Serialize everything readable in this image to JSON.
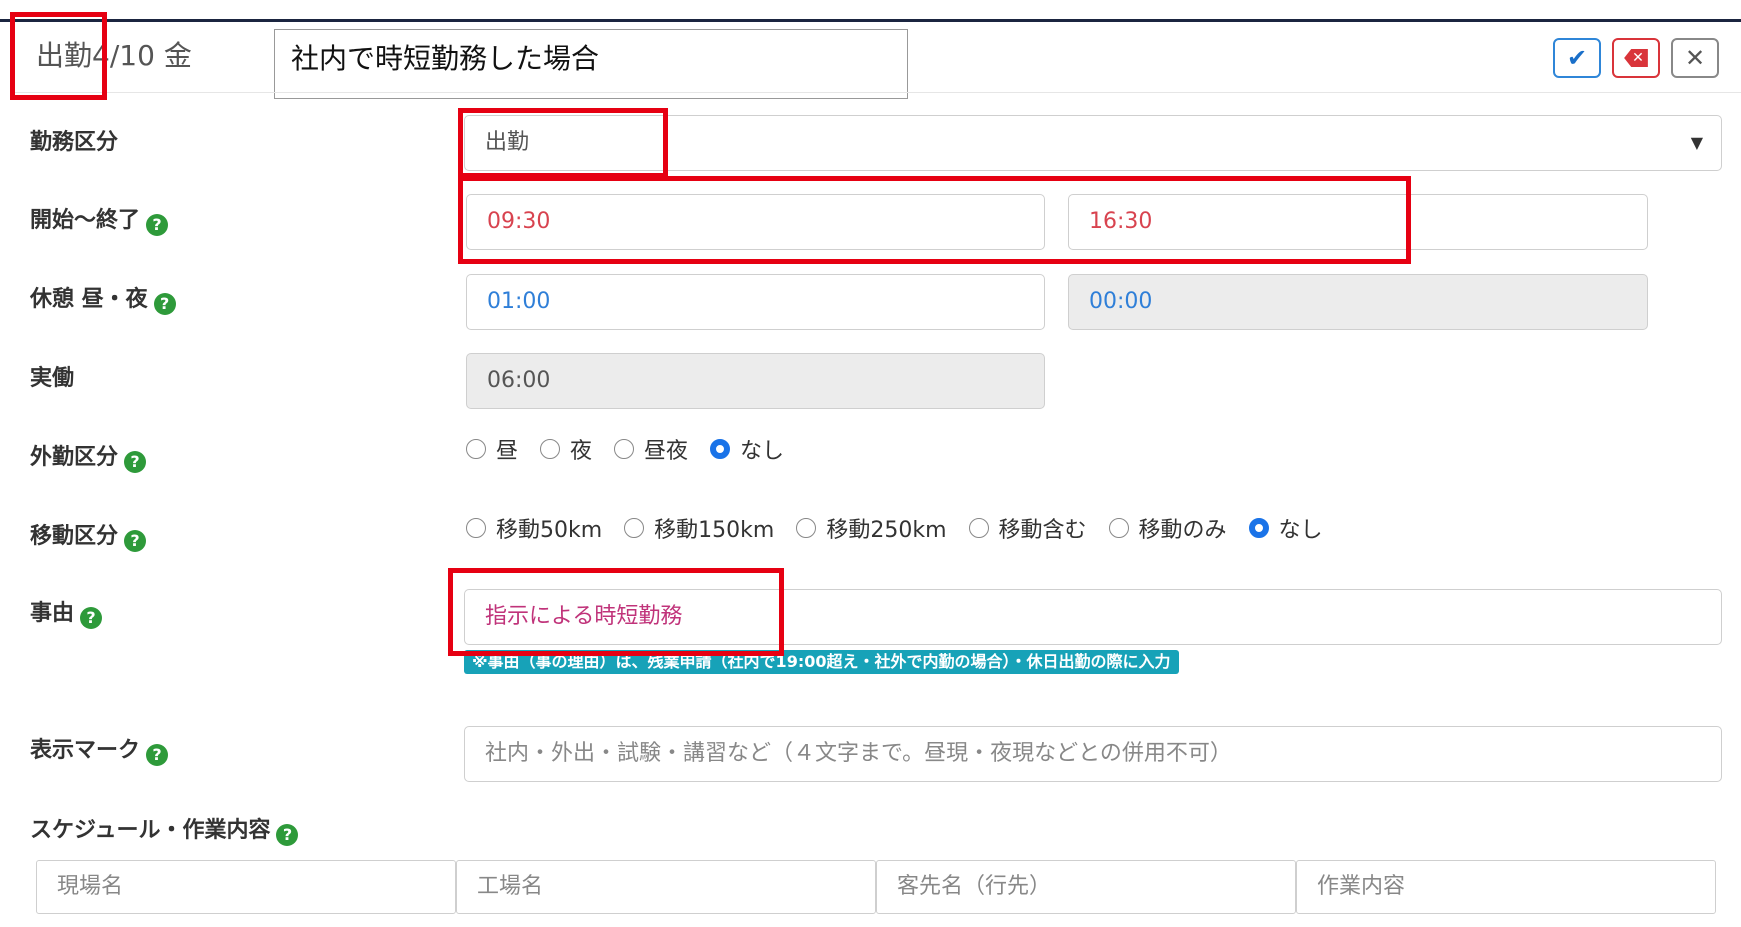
{
  "header": {
    "day_type": "出勤",
    "date": "4/10",
    "weekday": "金",
    "note": "社内で時短勤務した場合",
    "buttons": {
      "confirm_icon": "checkmark-icon",
      "delete_icon": "backspace-x-icon",
      "close_icon": "close-icon",
      "confirm_glyph": "✔",
      "delete_glyph": "✕",
      "close_glyph": "✕"
    }
  },
  "form": {
    "work_type": {
      "label": "勤務区分",
      "value": "出勤",
      "caret": "▼"
    },
    "start_end": {
      "label": "開始～終了",
      "start": "09:30",
      "end": "16:30"
    },
    "break": {
      "label": "休憩 昼・夜",
      "day": "01:00",
      "night": "00:00"
    },
    "actual": {
      "label": "実働",
      "value": "06:00"
    },
    "outside_work": {
      "label": "外勤区分",
      "options": [
        "昼",
        "夜",
        "昼夜",
        "なし"
      ],
      "selected": "なし"
    },
    "travel": {
      "label": "移動区分",
      "options": [
        "移動50km",
        "移動150km",
        "移動250km",
        "移動含む",
        "移動のみ",
        "なし"
      ],
      "selected": "なし"
    },
    "reason": {
      "label": "事由",
      "value": "指示による時短勤務",
      "note": "※事由（事の理由）は、残業申請（社内で19:00超え・社外で内勤の場合）・休日出勤の際に入力"
    },
    "display_mark": {
      "label": "表示マーク",
      "placeholder": "社内・外出・試験・講習など（４文字まで。昼現・夜現などとの併用不可）"
    },
    "schedule": {
      "label": "スケジュール・作業内容",
      "placeholders": [
        "現場名",
        "工場名",
        "客先名（行先）",
        "作業内容"
      ]
    },
    "help_glyph": "?"
  },
  "colors": {
    "annotation_red": "#e60012",
    "time_red": "#d8434f",
    "break_blue": "#2f7fd8",
    "reason_pink": "#c0337a",
    "note_teal": "#17a2b8",
    "help_green": "#2e9a3a"
  }
}
